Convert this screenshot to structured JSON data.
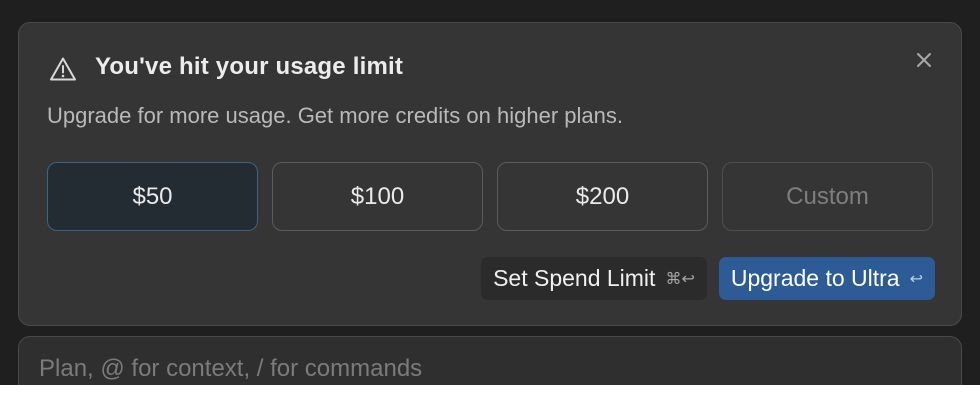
{
  "dialog": {
    "title": "You've hit your usage limit",
    "subtitle": "Upgrade for more usage. Get more credits on higher plans.",
    "warning_icon": "warning-triangle-icon",
    "close_icon": "close-icon",
    "options": [
      {
        "label": "$50",
        "selected": true
      },
      {
        "label": "$100",
        "selected": false
      },
      {
        "label": "$200",
        "selected": false
      },
      {
        "label": "Custom",
        "selected": false
      }
    ],
    "actions": {
      "spend_limit_label": "Set Spend Limit",
      "spend_limit_shortcut": "⌘↩",
      "upgrade_label": "Upgrade to Ultra",
      "upgrade_shortcut": "↩"
    }
  },
  "composer": {
    "placeholder": "Plan, @ for context, / for commands"
  },
  "colors": {
    "background": "#1f1f1f",
    "panel": "#353535",
    "selected_option_border": "#3a6488",
    "primary_button": "#2c5b96"
  }
}
